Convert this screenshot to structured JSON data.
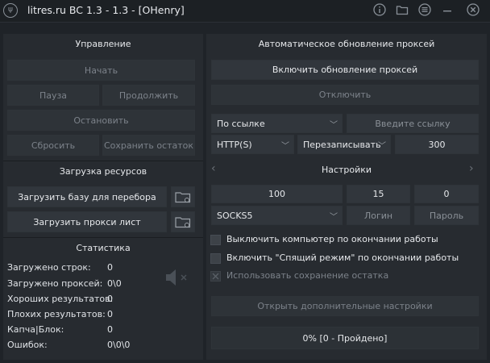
{
  "window": {
    "title": "litres.ru BC 1.3 - 1.3 - [OHenry]",
    "icons": [
      "app-logo-icon",
      "info-icon",
      "folder-icon",
      "menu-icon",
      "close-icon"
    ]
  },
  "left": {
    "control_header": "Управление",
    "start": "Начать",
    "pause": "Пауза",
    "resume": "Продолжить",
    "stop": "Остановить",
    "reset": "Сбросить",
    "save_rest": "Сохранить остаток",
    "resources_header": "Загрузка ресурсов",
    "load_base": "Загрузить базу для перебора",
    "load_proxy": "Загрузить прокси лист",
    "stats_header": "Статистика",
    "stats": [
      {
        "label": "Загружено строк:",
        "value": "0"
      },
      {
        "label": "Загружено проксей:",
        "value": "0\\0"
      },
      {
        "label": "Хороших результатов:",
        "value": "0"
      },
      {
        "label": "Плохих результатов:",
        "value": "0"
      },
      {
        "label": "Капча|Блок:",
        "value": "0"
      },
      {
        "label": "Ошибок:",
        "value": "0\\0\\0"
      }
    ]
  },
  "right": {
    "proxy_header": "Автоматическое обновление проксей",
    "enable_update": "Включить обновление проксей",
    "disable": "Отключить",
    "source_select": "По ссылке",
    "url_placeholder": "Введите ссылку",
    "proxy_type": "HTTP(S)",
    "write_mode": "Перезаписывать",
    "interval": "300",
    "settings_header": "Настройки",
    "threads": "100",
    "timeout": "15",
    "retries": "0",
    "socks_type": "SOCKS5",
    "login": "Логин",
    "password": "Пароль",
    "shutdown_label": "Выключить компьютер по окончании работы",
    "sleep_label": "Включить \"Спящий режим\" по окончании работы",
    "save_rest_label": "Использовать сохранение остатка",
    "more_settings": "Открыть дополнительные настройки",
    "progress": "0% [0 - Пройдено]"
  }
}
